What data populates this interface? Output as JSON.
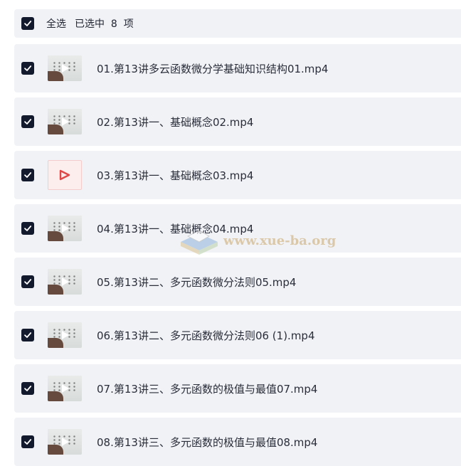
{
  "header": {
    "select_all": "全选",
    "selected_summary": "已选中  8  项",
    "checked": true
  },
  "files": [
    {
      "name": "01.第13讲多云函数微分学基础知识结构01.mp4",
      "thumb": "video-thumbnail",
      "checked": true
    },
    {
      "name": "02.第13讲一、基础概念02.mp4",
      "thumb": "video-thumbnail",
      "checked": true
    },
    {
      "name": "03.第13讲一、基础概念03.mp4",
      "thumb": "video-file-icon",
      "checked": true
    },
    {
      "name": "04.第13讲一、基础概念04.mp4",
      "thumb": "video-thumbnail",
      "checked": true
    },
    {
      "name": "05.第13讲二、多元函数微分法则05.mp4",
      "thumb": "video-thumbnail",
      "checked": true
    },
    {
      "name": "06.第13讲二、多元函数微分法则06 (1).mp4",
      "thumb": "video-thumbnail",
      "checked": true
    },
    {
      "name": "07.第13讲三、多元函数的极值与最值07.mp4",
      "thumb": "video-thumbnail",
      "checked": true
    },
    {
      "name": "08.第13讲三、多元函数的极值与最值08.mp4",
      "thumb": "video-thumbnail",
      "checked": true
    }
  ],
  "watermark": {
    "text": "www.xue-ba.org"
  },
  "colors": {
    "row_bg": "#f1f2f6",
    "checkbox": "#131a2e",
    "video_icon_red": "#e04848"
  }
}
